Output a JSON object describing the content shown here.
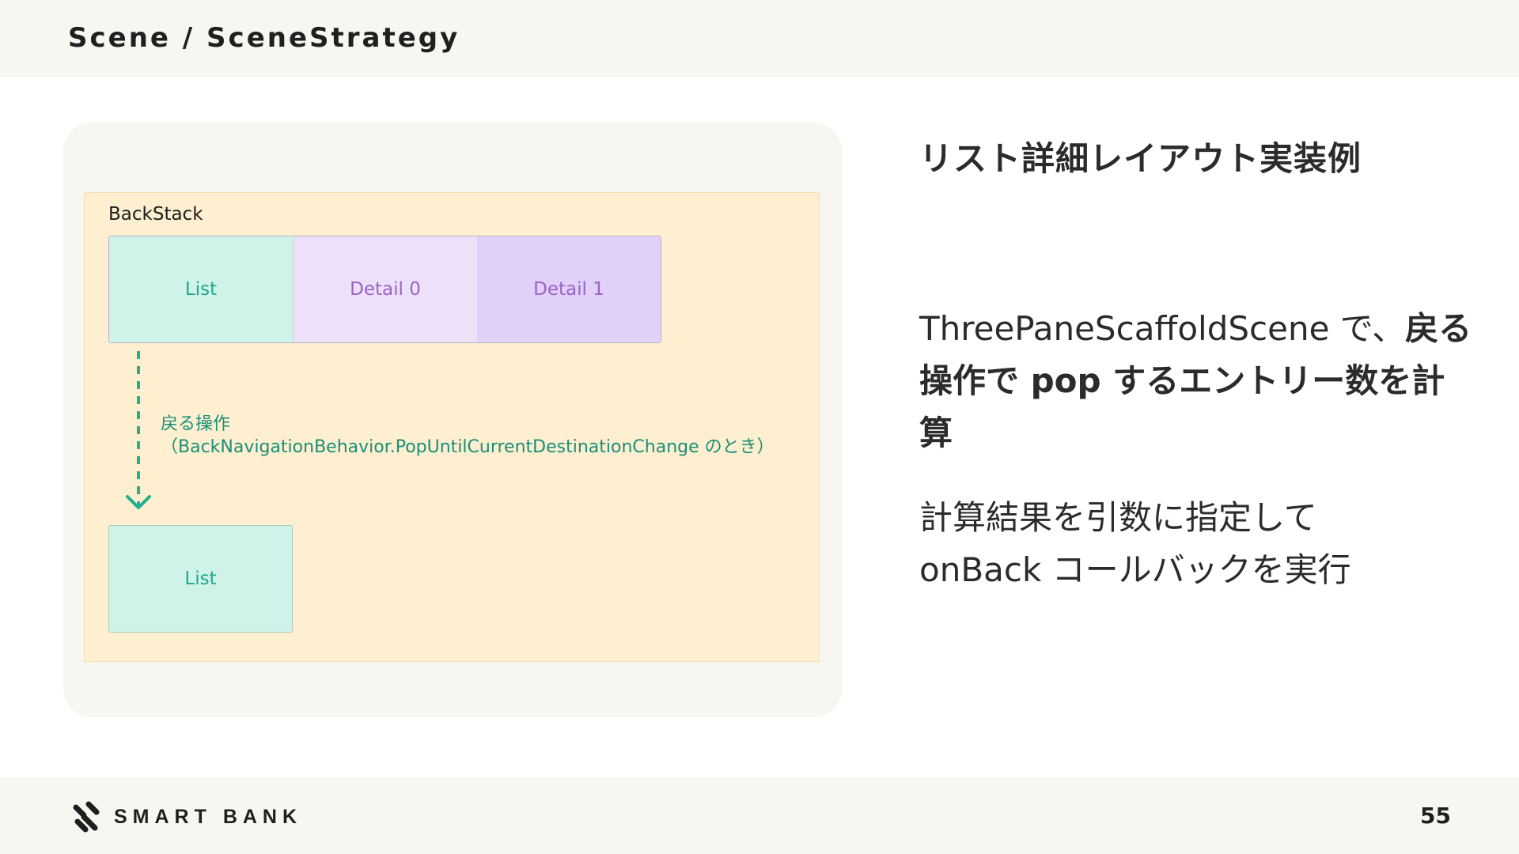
{
  "header": {
    "breadcrumb": "Scene / SceneStrategy"
  },
  "diagram": {
    "backstack_label": "BackStack",
    "entries": [
      "List",
      "Detail 0",
      "Detail 1"
    ],
    "operation_line1": "戻る操作",
    "operation_line2": "（BackNavigationBehavior.PopUntilCurrentDestinationChange のとき）",
    "result_entry": "List",
    "colors": {
      "list_fill": "#cff3e9",
      "list_text": "#1fa98e",
      "detail0_fill": "#ede0fb",
      "detail1_fill": "#e1d0f8",
      "detail_text": "#9b63c5",
      "backstack_fill": "#fdefcf",
      "arrow": "#1fb08f"
    }
  },
  "content": {
    "heading": "リスト詳細レイアウト実装例",
    "para1_normal": "ThreePaneScaffoldScene で、",
    "para1_bold": "戻る操作で pop するエントリー数を計算",
    "para2_line1": "計算結果を引数に指定して",
    "para2_line2": "onBack コールバックを実行"
  },
  "footer": {
    "logo_text": "SMART BANK",
    "page_number": "55"
  }
}
